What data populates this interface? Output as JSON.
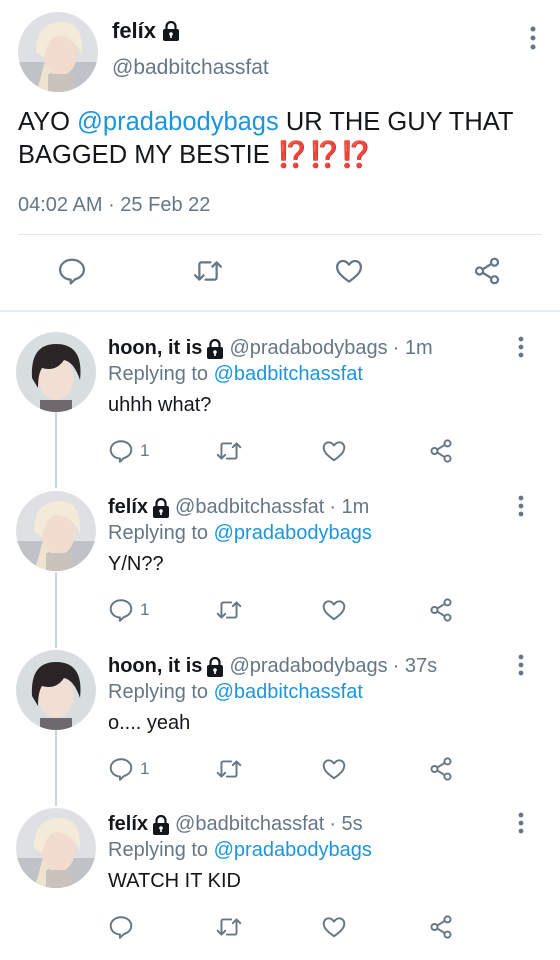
{
  "main_tweet": {
    "name": "felíx",
    "handle": "@badbitchassfat",
    "text_prefix": "AYO ",
    "mention": "@pradabodybags",
    "text_suffix": " UR THE GUY THAT BAGGED MY BESTIE ",
    "emphasis": "⁉️⁉️⁉️",
    "time": "04:02 AM",
    "date_sep": " · ",
    "date": "25 Feb 22",
    "actions": [
      "reply-icon",
      "retweet-icon",
      "like-icon",
      "share-icon"
    ]
  },
  "replies": [
    {
      "name": "hoon, it is",
      "handle": "@pradabodybags",
      "time": "· 1m",
      "replying_prefix": "Replying to ",
      "replying_to": "@badbitchassfat",
      "text": "uhhh what?",
      "reply_count": "1",
      "avatar": "dark-hair"
    },
    {
      "name": "felíx",
      "handle": "@badbitchassfat",
      "time": "· 1m",
      "replying_prefix": "Replying to ",
      "replying_to": "@pradabodybags",
      "text": "Y/N??",
      "reply_count": "1",
      "avatar": "blonde-hair"
    },
    {
      "name": "hoon, it is",
      "handle": "@pradabodybags",
      "time": "· 37s",
      "replying_prefix": "Replying to ",
      "replying_to": "@badbitchassfat",
      "text": "o.... yeah",
      "reply_count": "1",
      "avatar": "dark-hair"
    },
    {
      "name": "felíx",
      "handle": "@badbitchassfat",
      "time": "· 5s",
      "replying_prefix": "Replying to ",
      "replying_to": "@pradabodybags",
      "text": "WATCH IT KID",
      "reply_count": "",
      "avatar": "blonde-hair"
    }
  ],
  "colors": {
    "link": "#1b95e0",
    "secondary_text": "#657786",
    "icon": "#657786",
    "emphasis": "#e0242f",
    "divider": "#e1e8ed",
    "thread_line": "#ccd6dd"
  }
}
